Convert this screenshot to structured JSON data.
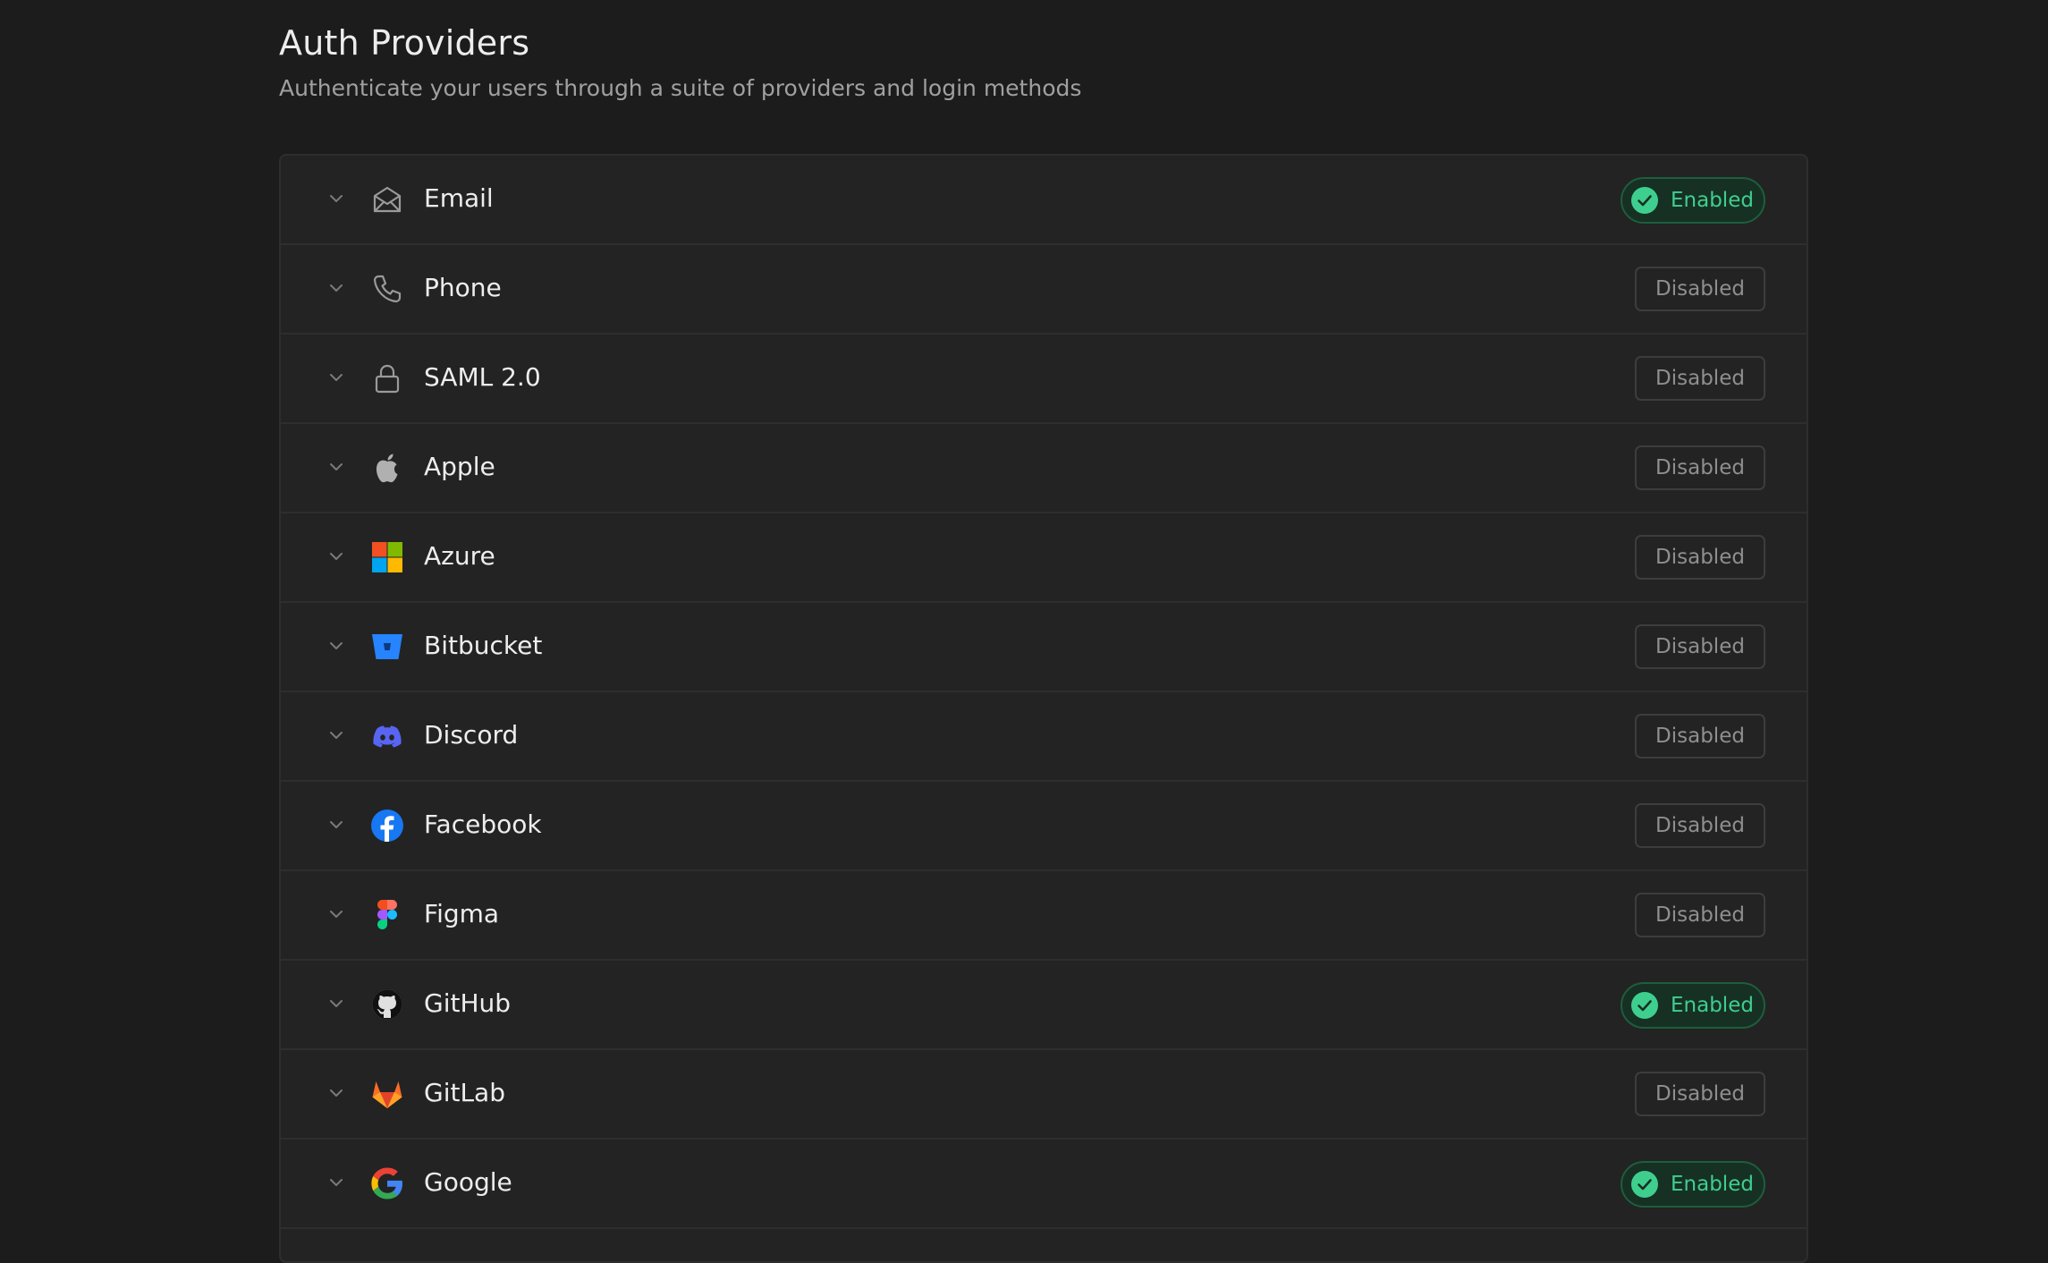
{
  "header": {
    "title": "Auth Providers",
    "subtitle": "Authenticate your users through a suite of providers and login methods"
  },
  "colors": {
    "background": "#1c1c1c",
    "panel": "#232323",
    "enabled_text": "#3ecf8e",
    "enabled_bg": "#173024",
    "disabled_text": "#8f8f8f"
  },
  "providers": [
    {
      "label": "Email",
      "icon": "email-icon",
      "status": "Enabled"
    },
    {
      "label": "Phone",
      "icon": "phone-icon",
      "status": "Disabled"
    },
    {
      "label": "SAML 2.0",
      "icon": "lock-icon",
      "status": "Disabled"
    },
    {
      "label": "Apple",
      "icon": "apple-icon",
      "status": "Disabled"
    },
    {
      "label": "Azure",
      "icon": "azure-icon",
      "status": "Disabled"
    },
    {
      "label": "Bitbucket",
      "icon": "bitbucket-icon",
      "status": "Disabled"
    },
    {
      "label": "Discord",
      "icon": "discord-icon",
      "status": "Disabled"
    },
    {
      "label": "Facebook",
      "icon": "facebook-icon",
      "status": "Disabled"
    },
    {
      "label": "Figma",
      "icon": "figma-icon",
      "status": "Disabled"
    },
    {
      "label": "GitHub",
      "icon": "github-icon",
      "status": "Enabled"
    },
    {
      "label": "GitLab",
      "icon": "gitlab-icon",
      "status": "Disabled"
    },
    {
      "label": "Google",
      "icon": "google-icon",
      "status": "Enabled"
    }
  ]
}
